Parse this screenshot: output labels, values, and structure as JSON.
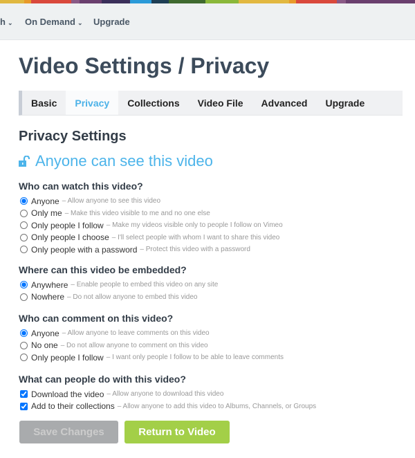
{
  "brand_colors": [
    "#e0b840",
    "#e89a2a",
    "#d9493c",
    "#8a5a86",
    "#6a3f6e",
    "#3a2f5a",
    "#2a9ad8",
    "#1e3f55",
    "#3f6a2f",
    "#8ab83a",
    "#e2b840",
    "#e89a2a",
    "#d9493c",
    "#8a5a86",
    "#6a3f6e"
  ],
  "nav": {
    "items": [
      {
        "label": "h",
        "has_dropdown": true
      },
      {
        "label": "On Demand",
        "has_dropdown": true
      },
      {
        "label": "Upgrade",
        "has_dropdown": false
      }
    ]
  },
  "page_title": "Video Settings / Privacy",
  "tabs": [
    {
      "label": "Basic"
    },
    {
      "label": "Privacy",
      "active": true
    },
    {
      "label": "Collections"
    },
    {
      "label": "Video File"
    },
    {
      "label": "Advanced"
    },
    {
      "label": "Upgrade"
    }
  ],
  "section_title": "Privacy Settings",
  "status": {
    "icon": "unlock-icon",
    "text": "Anyone can see this video",
    "color": "#4cb4ea"
  },
  "watch": {
    "heading": "Who can watch this video?",
    "options": [
      {
        "label": "Anyone",
        "desc": "– Allow anyone to see this video",
        "checked": true
      },
      {
        "label": "Only me",
        "desc": "– Make this video visible to me and no one else",
        "checked": false
      },
      {
        "label": "Only people I follow",
        "desc": "– Make my videos visible only to people I follow on Vimeo",
        "checked": false
      },
      {
        "label": "Only people I choose",
        "desc": "– I'll select people with whom I want to share this video",
        "checked": false
      },
      {
        "label": "Only people with a password",
        "desc": "– Protect this video with a password",
        "checked": false
      }
    ]
  },
  "embed": {
    "heading": "Where can this video be embedded?",
    "options": [
      {
        "label": "Anywhere",
        "desc": "– Enable people to embed this video on any site",
        "checked": true
      },
      {
        "label": "Nowhere",
        "desc": "– Do not allow anyone to embed this video",
        "checked": false
      }
    ]
  },
  "comment": {
    "heading": "Who can comment on this video?",
    "options": [
      {
        "label": "Anyone",
        "desc": "– Allow anyone to leave comments on this video",
        "checked": true
      },
      {
        "label": "No one",
        "desc": "– Do not allow anyone to comment on this video",
        "checked": false
      },
      {
        "label": "Only people I follow",
        "desc": "– I want only people I follow to be able to leave comments",
        "checked": false
      }
    ]
  },
  "actions": {
    "heading": "What can people do with this video?",
    "options": [
      {
        "label": "Download the video",
        "desc": "– Allow anyone to download this video",
        "checked": true
      },
      {
        "label": "Add to their collections",
        "desc": "– Allow anyone to add this video to Albums, Channels, or Groups",
        "checked": true
      }
    ]
  },
  "buttons": {
    "save": "Save Changes",
    "return": "Return to Video"
  }
}
